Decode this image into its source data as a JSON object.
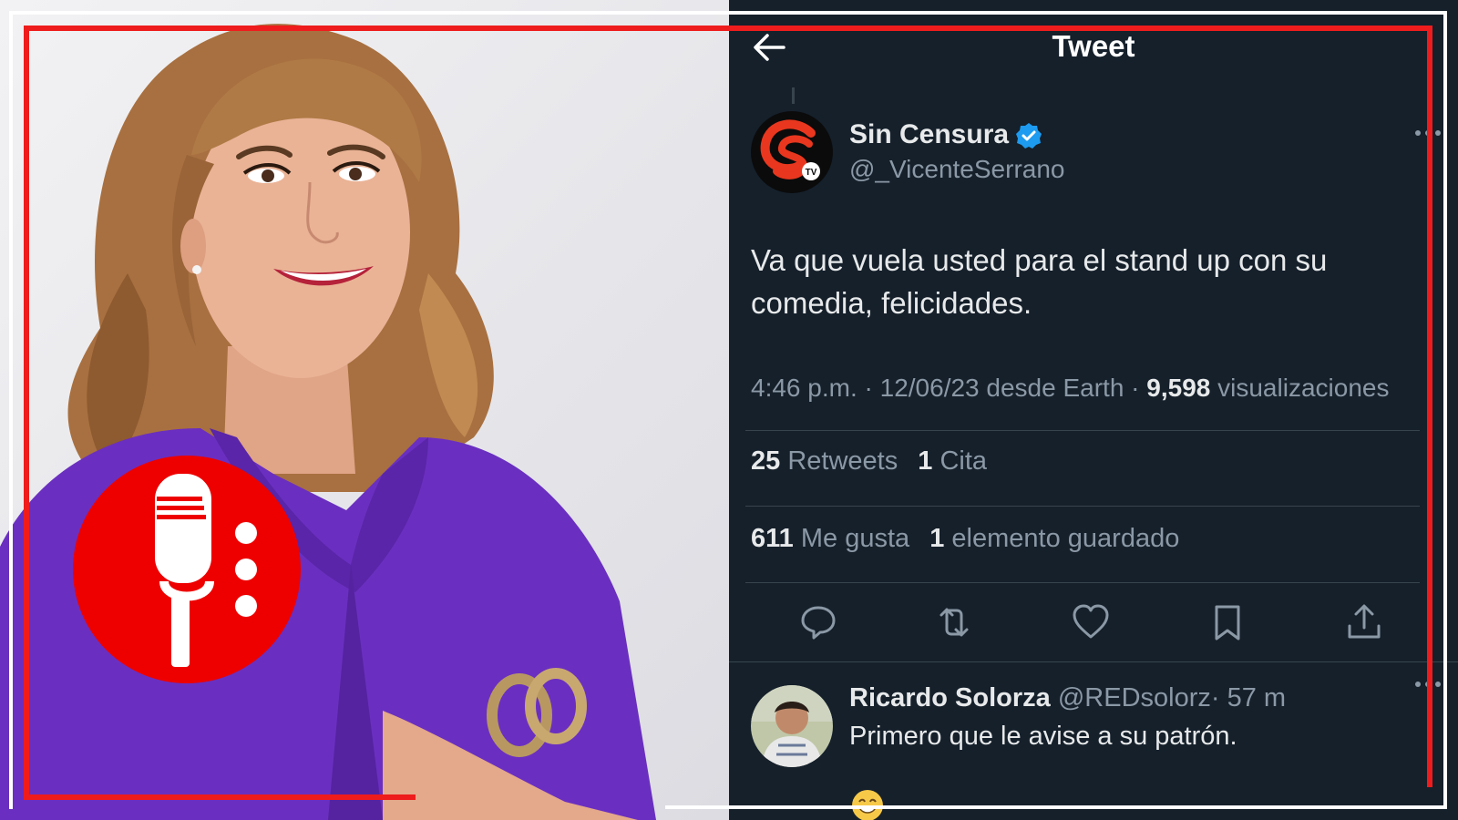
{
  "header": {
    "title": "Tweet"
  },
  "tweet": {
    "author_name": "Sin Censura",
    "author_handle": "@_VicenteSerrano",
    "text": "Va que vuela usted para el stand up con su comedia, felicidades.",
    "meta": {
      "time": "4:46 p.m.",
      "separator": "·",
      "date_source": "12/06/23 desde Earth",
      "views_count": "9,598",
      "views_label": "visualizaciones"
    },
    "retweets_count": "25",
    "retweets_label": "Retweets",
    "quotes_count": "1",
    "quotes_label": "Cita",
    "likes_count": "611",
    "likes_label": "Me gusta",
    "bookmarks_count": "1",
    "bookmarks_label": "elemento guardado"
  },
  "reply": {
    "name": "Ricardo Solorza",
    "handle": "@REDsolorz",
    "time": "· 57 m",
    "text": "Primero que le avise a su patrón."
  },
  "icons": {
    "back": "back-arrow-icon",
    "verified": "verified-badge-icon",
    "more": "more-horizontal-icon",
    "reply": "reply-icon",
    "retweet": "retweet-icon",
    "like": "heart-icon",
    "bookmark": "bookmark-icon",
    "share": "share-icon",
    "podcast": "microphone-icon"
  },
  "colors": {
    "tweet_background": "#15202b",
    "accent_red": "#ee1c1c",
    "verified_blue": "#1d9bf0",
    "primary_text": "#e7e9ea",
    "secondary_text": "#8b98a5"
  }
}
